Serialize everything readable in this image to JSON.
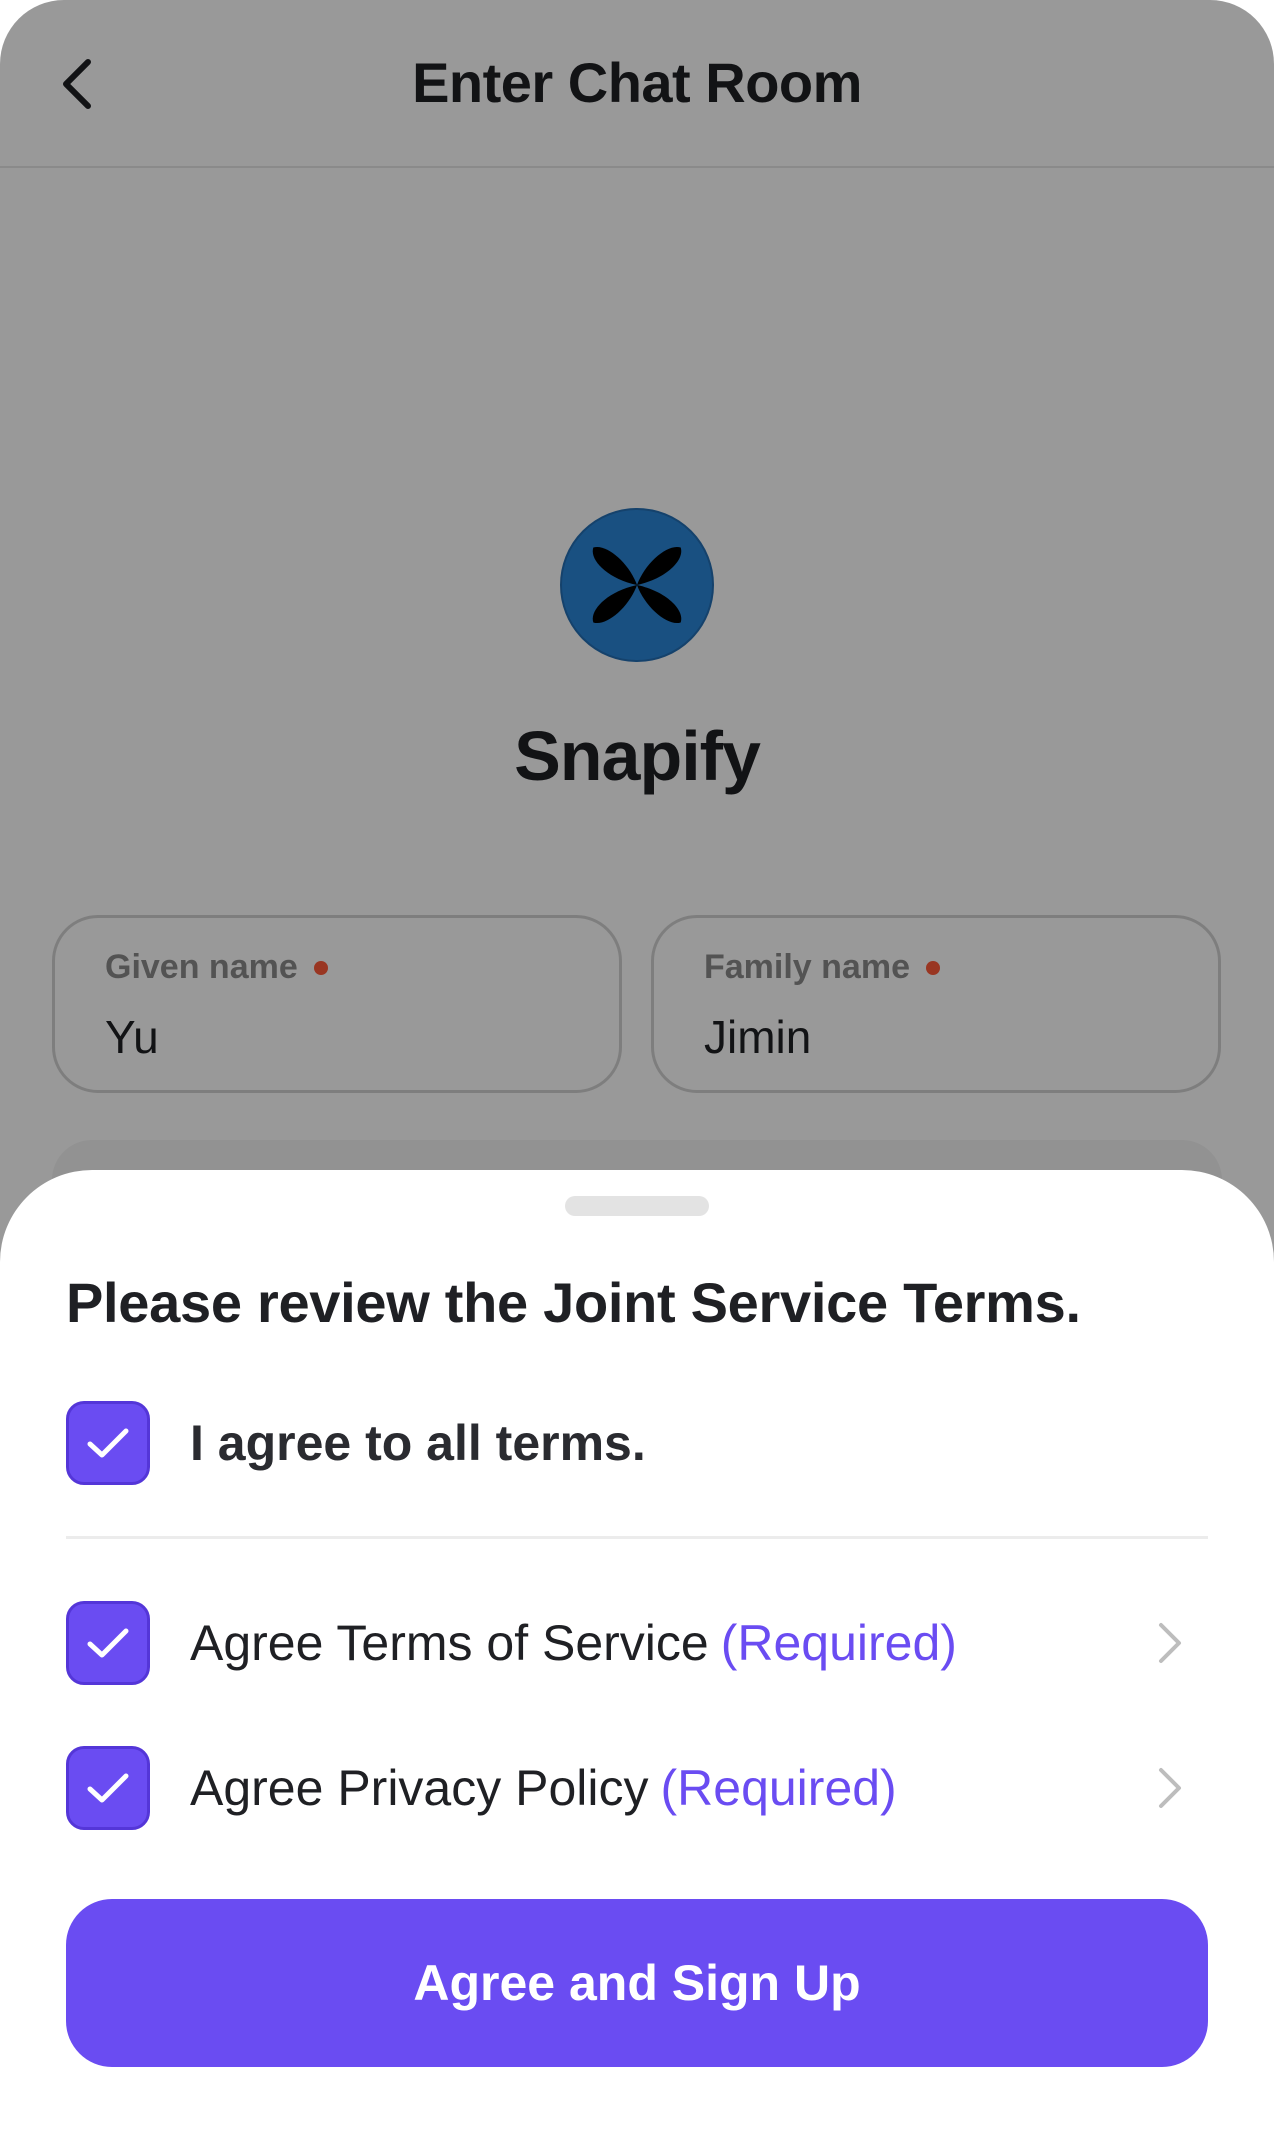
{
  "header": {
    "title": "Enter Chat Room",
    "back_icon": "chevron-left-icon"
  },
  "brand": {
    "name": "Snapify",
    "logo_icon": "four-petal-logo-icon",
    "logo_color": "#2a85d8"
  },
  "form": {
    "given_name": {
      "label": "Given name",
      "value": "Yu"
    },
    "family_name": {
      "label": "Family name",
      "value": "Jimin"
    },
    "required_indicator_color": "#ff5a3a"
  },
  "terms_sheet": {
    "title": "Please review the Joint Service Terms.",
    "agree_all": {
      "label": "I agree to all terms.",
      "checked": true
    },
    "items": [
      {
        "label": "Agree Terms of Service",
        "tag": "(Required)",
        "checked": true
      },
      {
        "label": "Agree Privacy Policy",
        "tag": "(Required)",
        "checked": true
      }
    ],
    "submit_label": "Agree and Sign Up"
  },
  "colors": {
    "accent": "#6a4cf2",
    "text": "#1f2024",
    "overlay": "rgba(0,0,0,0.40)"
  }
}
